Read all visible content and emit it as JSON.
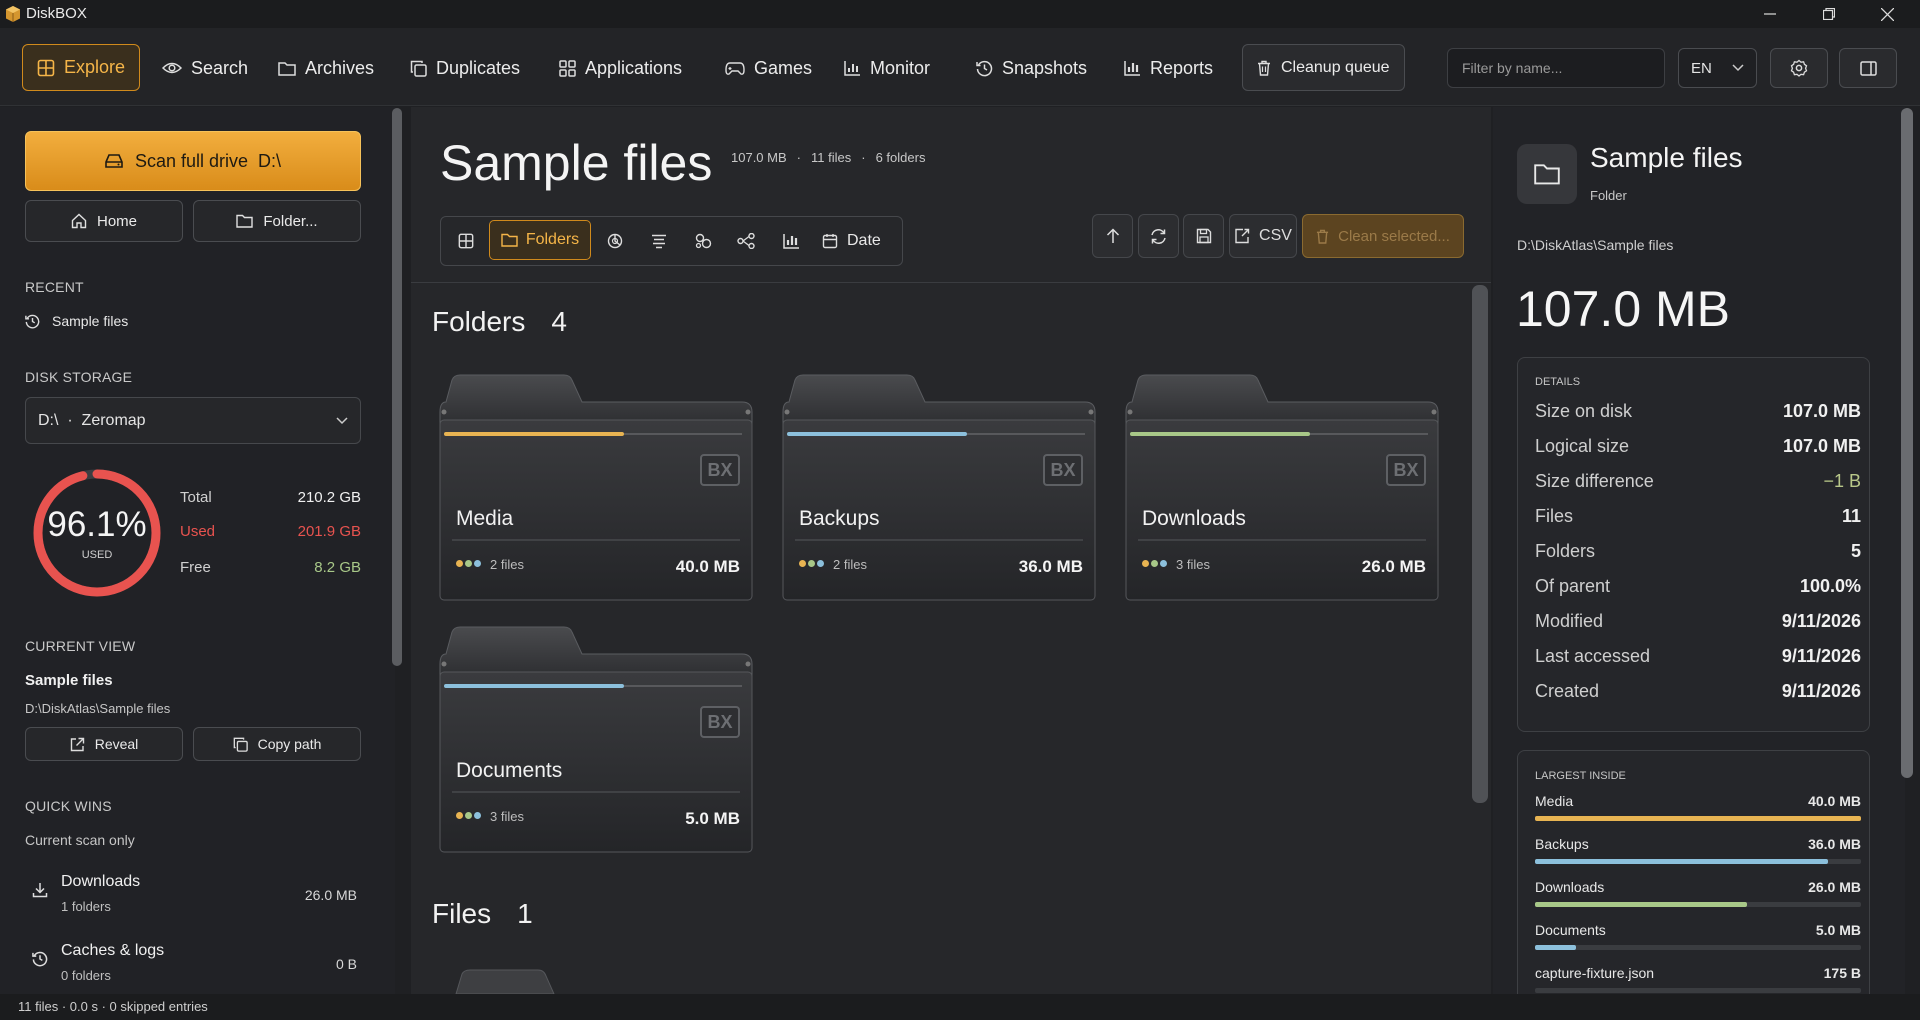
{
  "app": {
    "title": "DiskBOX"
  },
  "nav": {
    "items": [
      {
        "label": "Explore",
        "icon": "grid-icon"
      },
      {
        "label": "Search",
        "icon": "eye-icon"
      },
      {
        "label": "Archives",
        "icon": "folder-icon"
      },
      {
        "label": "Duplicates",
        "icon": "copy-icon"
      },
      {
        "label": "Applications",
        "icon": "apps-icon"
      },
      {
        "label": "Games",
        "icon": "gamepad-icon"
      },
      {
        "label": "Monitor",
        "icon": "bar-chart-icon"
      },
      {
        "label": "Snapshots",
        "icon": "history-icon"
      },
      {
        "label": "Reports",
        "icon": "report-icon"
      }
    ],
    "cleanup_label": "Cleanup queue",
    "filter_placeholder": "Filter by name...",
    "language": "EN"
  },
  "sidebar": {
    "scan_label": "Scan full drive  D:\\",
    "home_label": "Home",
    "folder_label": "Folder...",
    "recent_title": "RECENT",
    "recent_items": [
      "Sample files"
    ],
    "disk_title": "DISK STORAGE",
    "disk_select": "D:\\  ·  Zeromap",
    "usage_percent": "96.1%",
    "usage_fraction": 0.961,
    "usage_caption": "USED",
    "total_label": "Total",
    "total_value": "210.2 GB",
    "used_label": "Used",
    "used_value": "201.9 GB",
    "free_label": "Free",
    "free_value": "8.2 GB",
    "current_title": "CURRENT VIEW",
    "current_name": "Sample files",
    "current_path": "D:\\DiskAtlas\\Sample files",
    "reveal_label": "Reveal",
    "copy_path_label": "Copy path",
    "quick_title": "QUICK WINS",
    "quick_sub": "Current scan only",
    "quick_items": [
      {
        "name": "Downloads",
        "sub": "1 folders",
        "size": "26.0 MB"
      },
      {
        "name": "Caches & logs",
        "sub": "0 folders",
        "size": "0 B"
      }
    ]
  },
  "main": {
    "title": "Sample files",
    "meta_size": "107.0 MB",
    "meta_files": "11 files",
    "meta_folders": "6 folders",
    "sep": "·",
    "view_folders_label": "Folders",
    "view_date_label": "Date",
    "csv_label": "CSV",
    "clean_label": "Clean selected...",
    "folders_heading": "Folders",
    "folders_count": "4",
    "files_heading": "Files",
    "files_count": "1",
    "badge": "BX",
    "folders": [
      {
        "name": "Media",
        "files": "2 files",
        "size": "40.0 MB",
        "accent": "#e8b452"
      },
      {
        "name": "Backups",
        "files": "2 files",
        "size": "36.0 MB",
        "accent": "#8cc0dc"
      },
      {
        "name": "Downloads",
        "files": "3 files",
        "size": "26.0 MB",
        "accent": "#a8c888"
      },
      {
        "name": "Documents",
        "files": "3 files",
        "size": "5.0 MB",
        "accent": "#8cc0dc"
      }
    ]
  },
  "details": {
    "name": "Sample files",
    "type": "Folder",
    "path": "D:\\DiskAtlas\\Sample files",
    "size": "107.0 MB",
    "section_title": "DETAILS",
    "rows": [
      {
        "k": "Size on disk",
        "v": "107.0 MB"
      },
      {
        "k": "Logical size",
        "v": "107.0 MB"
      },
      {
        "k": "Size difference",
        "v": "−1 B"
      },
      {
        "k": "Files",
        "v": "11"
      },
      {
        "k": "Folders",
        "v": "5"
      },
      {
        "k": "Of parent",
        "v": "100.0%"
      },
      {
        "k": "Modified",
        "v": "9/11/2026"
      },
      {
        "k": "Last accessed",
        "v": "9/11/2026"
      },
      {
        "k": "Created",
        "v": "9/11/2026"
      }
    ],
    "largest_title": "LARGEST INSIDE",
    "largest": [
      {
        "name": "Media",
        "size": "40.0 MB",
        "fraction": 1.0,
        "color": "#e8b452"
      },
      {
        "name": "Backups",
        "size": "36.0 MB",
        "fraction": 0.9,
        "color": "#8cc0dc"
      },
      {
        "name": "Downloads",
        "size": "26.0 MB",
        "fraction": 0.65,
        "color": "#a8c888"
      },
      {
        "name": "Documents",
        "size": "5.0 MB",
        "fraction": 0.125,
        "color": "#8cc0dc"
      },
      {
        "name": "capture-fixture.json",
        "size": "175 B",
        "fraction": 0.0,
        "color": "#8cc0dc"
      }
    ]
  },
  "status": {
    "text": "11 files · 0.0 s · 0 skipped entries"
  },
  "colors": {
    "accent": "#f0a830",
    "used": "#e8534f",
    "free": "#a8c888",
    "diff": "#b9c88a"
  }
}
